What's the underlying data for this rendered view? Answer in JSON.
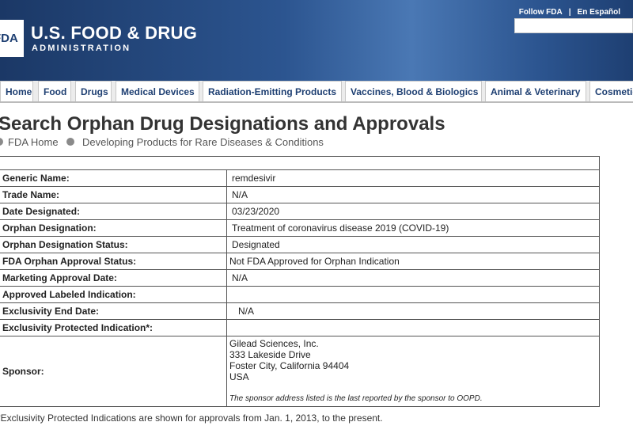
{
  "header": {
    "logo_mark": "FDA",
    "title": "U.S. FOOD & DRUG",
    "subtitle": "ADMINISTRATION",
    "follow_link": "Follow FDA",
    "separator": "|",
    "spanish_link": "En Español",
    "search_placeholder": ""
  },
  "nav": {
    "tabs": [
      {
        "label": "Home"
      },
      {
        "label": "Food"
      },
      {
        "label": "Drugs"
      },
      {
        "label": "Medical Devices"
      },
      {
        "label": "Radiation-Emitting Products"
      },
      {
        "label": "Vaccines, Blood & Biologics"
      },
      {
        "label": "Animal & Veterinary"
      },
      {
        "label": "Cosmetics"
      }
    ]
  },
  "page": {
    "title": "Search Orphan Drug Designations and Approvals",
    "breadcrumbs": [
      "FDA Home",
      "Developing Products for Rare Diseases & Conditions"
    ]
  },
  "record": {
    "rows": [
      {
        "label": "Generic Name:",
        "value": "remdesivir"
      },
      {
        "label": "Trade Name:",
        "value": "N/A"
      },
      {
        "label": "Date Designated:",
        "value": "03/23/2020"
      },
      {
        "label": "Orphan Designation:",
        "value": "Treatment of coronavirus disease 2019 (COVID-19)"
      },
      {
        "label": "Orphan Designation Status:",
        "value": "Designated"
      },
      {
        "label": "FDA Orphan Approval Status:",
        "value": "Not FDA Approved for Orphan Indication"
      },
      {
        "label": "Marketing Approval Date:",
        "value": "N/A"
      },
      {
        "label": "Approved Labeled Indication:",
        "value": ""
      },
      {
        "label": "Exclusivity End Date:",
        "value": "N/A"
      },
      {
        "label": "Exclusivity Protected Indication*:",
        "value": ""
      }
    ],
    "sponsor": {
      "label": "Sponsor:",
      "lines": [
        "Gilead Sciences, Inc.",
        "333 Lakeside Drive",
        "Foster City, California 94404",
        "USA"
      ],
      "note": "The sponsor address listed is the last reported by the sponsor to OOPD."
    }
  },
  "footnote": "*Exclusivity Protected Indications are shown for approvals from Jan. 1, 2013, to the present."
}
